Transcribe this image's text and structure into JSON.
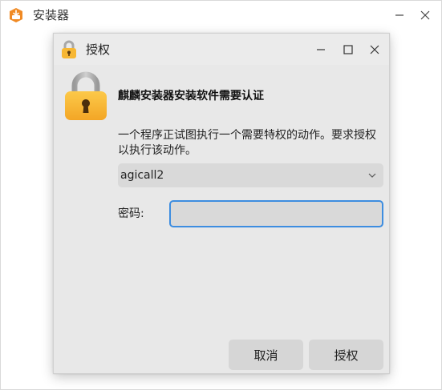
{
  "background_window": {
    "title": "安装器",
    "icon": "installer-app-icon",
    "controls": {
      "minimize_icon": "minimize-icon",
      "close_icon": "close-icon"
    }
  },
  "dialog": {
    "title": "授权",
    "icon": "lock-icon",
    "controls": {
      "minimize_icon": "minimize-icon",
      "maximize_icon": "maximize-icon",
      "close_icon": "close-icon"
    },
    "heading": "麒麟安装器安装软件需要认证",
    "message": "一个程序正试图执行一个需要特权的动作。要求授权以执行该动作。",
    "user_select": {
      "selected": "agicall2",
      "icon": "chevron-down-icon"
    },
    "password": {
      "label": "密码:",
      "value": "",
      "placeholder": ""
    },
    "buttons": {
      "cancel": "取消",
      "authorize": "授权"
    }
  },
  "colors": {
    "lock_body": "#f7b733",
    "lock_shackle": "#b0b0b0",
    "focus_border": "#3d8de0",
    "dialog_bg": "#e8e8e8",
    "button_bg": "#d6d6d6",
    "installer_icon": "#f08a24"
  }
}
